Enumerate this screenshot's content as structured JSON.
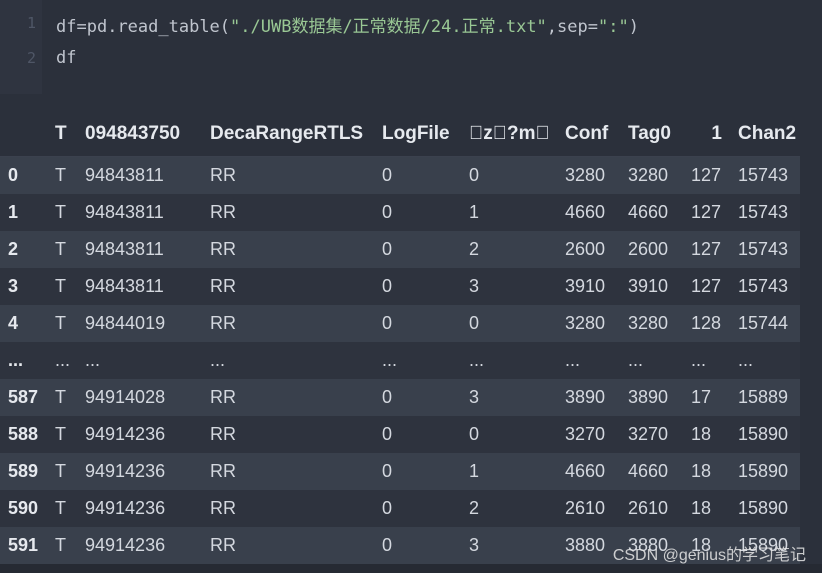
{
  "code_cell": {
    "line_numbers": [
      "1",
      "2"
    ],
    "line1": {
      "var": "df",
      "eq": "=",
      "call": "pd.read_table(",
      "path": "\"./UWB数据集/正常数据/24.正常.txt\"",
      "sep_kw": ",sep=",
      "sep_val": "\":\"",
      "close": ")"
    },
    "line2": "df"
  },
  "table": {
    "columns": [
      "",
      "T",
      "094843750",
      "DecaRangeRTLS",
      "LogFile",
      "\u0000z\u0000?m\u0000",
      "Conf",
      "Tag0",
      "1",
      "Chan2"
    ],
    "rows": [
      [
        "0",
        "T",
        "94843811",
        "RR",
        "0",
        "0",
        "3280",
        "3280",
        "127",
        "15743"
      ],
      [
        "1",
        "T",
        "94843811",
        "RR",
        "0",
        "1",
        "4660",
        "4660",
        "127",
        "15743"
      ],
      [
        "2",
        "T",
        "94843811",
        "RR",
        "0",
        "2",
        "2600",
        "2600",
        "127",
        "15743"
      ],
      [
        "3",
        "T",
        "94843811",
        "RR",
        "0",
        "3",
        "3910",
        "3910",
        "127",
        "15743"
      ],
      [
        "4",
        "T",
        "94844019",
        "RR",
        "0",
        "0",
        "3280",
        "3280",
        "128",
        "15744"
      ],
      [
        "...",
        "...",
        "...",
        "...",
        "...",
        "...",
        "...",
        "...",
        "...",
        "..."
      ],
      [
        "587",
        "T",
        "94914028",
        "RR",
        "0",
        "3",
        "3890",
        "3890",
        "17",
        "15889"
      ],
      [
        "588",
        "T",
        "94914236",
        "RR",
        "0",
        "0",
        "3270",
        "3270",
        "18",
        "15890"
      ],
      [
        "589",
        "T",
        "94914236",
        "RR",
        "0",
        "1",
        "4660",
        "4660",
        "18",
        "15890"
      ],
      [
        "590",
        "T",
        "94914236",
        "RR",
        "0",
        "2",
        "2610",
        "2610",
        "18",
        "15890"
      ],
      [
        "591",
        "T",
        "94914236",
        "RR",
        "0",
        "3",
        "3880",
        "3880",
        "18",
        "15890"
      ]
    ]
  },
  "watermark": "CSDN @genius的学习笔记",
  "colors": {
    "background": "#2b303b",
    "row_odd": "#39404c",
    "row_even": "#2e333e",
    "string": "#99c794",
    "text": "#d4d8df"
  }
}
